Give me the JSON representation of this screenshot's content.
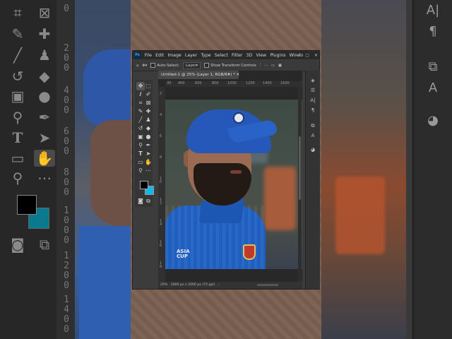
{
  "menu": {
    "logo": "Ps",
    "items": [
      "File",
      "Edit",
      "Image",
      "Layer",
      "Type",
      "Select",
      "Filter",
      "3D",
      "View",
      "Plugins",
      "Windo"
    ]
  },
  "options": {
    "auto_select_label": "Auto-Select:",
    "auto_select_value": "Layer",
    "transform_label": "Show Transform Controls"
  },
  "document": {
    "tab_title": "Untitled-1 @ 25% (Layer 1, RGB/8#) *",
    "ruler_top": [
      "30",
      "400",
      "600",
      "800",
      "1000",
      "1200",
      "1400",
      "1600"
    ],
    "ruler_left": [
      "2",
      "4",
      "6",
      "8",
      "1\n0",
      "1\n2",
      "1\n4",
      "1\n6",
      "1\n8"
    ],
    "jersey_text": "ASIA\nCUP"
  },
  "status": {
    "zoom": "25%",
    "size": "2000 px x 2000 px (72 ppi)"
  },
  "background_left": {
    "ruler_numbers": [
      "0",
      "2\n0\n0",
      "4\n0\n0",
      "6\n0\n0",
      "8\n0\n0",
      "1\n0\n0\n0",
      "1\n2\n0\n0",
      "1\n4\n0\n0"
    ]
  },
  "colors": {
    "foreground": "#000000",
    "background": "#0fb8e6",
    "app_bg": "#3c3c3c",
    "menubar_bg": "#2a2a2a",
    "jersey_blue": "#1f5fbf"
  },
  "icons": {
    "left_big": [
      "crop-icon",
      "frame-icon",
      "eyedropper-icon",
      "healing-brush-icon",
      "brush-icon",
      "stamp-icon",
      "history-brush-icon",
      "eraser-icon",
      "gradient-icon",
      "blur-icon",
      "dodge-icon",
      "pen-icon",
      "type-icon",
      "path-select-icon",
      "rectangle-icon",
      "hand-icon",
      "zoom-icon",
      "more-tools-icon"
    ],
    "right_big": [
      "character-icon",
      "paragraph-icon",
      "paths-icon",
      "glyphs-icon",
      "color-icon"
    ]
  }
}
